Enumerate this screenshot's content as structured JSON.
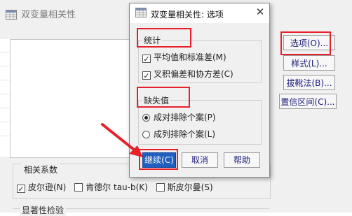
{
  "main_dialog": {
    "title": "双变量相关性",
    "side_buttons": [
      {
        "label": "选项(O)..."
      },
      {
        "label": "样式(L)..."
      },
      {
        "label": "拔靴法(B)..."
      },
      {
        "label": "置信区间(C)..."
      }
    ],
    "correlation": {
      "group_label": "相关系数",
      "options": [
        {
          "label": "皮尔逊(N)",
          "checked": true
        },
        {
          "label": "肯德尔 tau-b(K)",
          "checked": false
        },
        {
          "label": "斯皮尔曼(S)",
          "checked": false
        }
      ]
    },
    "significance_label": "显著性检验"
  },
  "options_dialog": {
    "title": "双变量相关性: 选项",
    "statistics": {
      "group_label": "统计",
      "options": [
        {
          "label": "平均值和标准差(M)",
          "checked": true
        },
        {
          "label": "叉积偏差和协方差(C)",
          "checked": true
        }
      ]
    },
    "missing": {
      "group_label": "缺失值",
      "options": [
        {
          "label": "成对排除个案(P)",
          "selected": true
        },
        {
          "label": "成列排除个案(L)",
          "selected": false
        }
      ]
    },
    "buttons": {
      "continue": "继续(C)",
      "cancel": "取消",
      "help": "帮助"
    }
  },
  "colors": {
    "annotation_red": "#e8202a",
    "continue_button": "#1f5fbf"
  }
}
